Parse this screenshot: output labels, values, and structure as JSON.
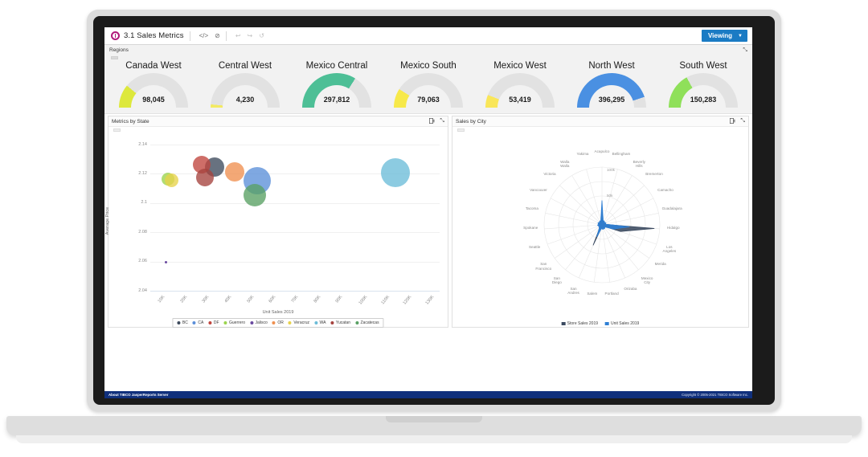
{
  "app": {
    "title": "3.1 Sales Metrics",
    "logo_icon": "jasper-logo-icon",
    "toolbar": {
      "code_icon": "</>",
      "timer_icon": "⊘",
      "undo_icon": "↩",
      "redo_icon": "↪",
      "refresh_icon": "↺"
    },
    "viewing_label": "Viewing",
    "viewing_caret": "▼"
  },
  "regions_panel": {
    "title": "Regions",
    "expand_icon": "⤡",
    "gauges": [
      {
        "name": "Canada West",
        "value": "98,045",
        "color": "#dde83c",
        "pct": 0.22
      },
      {
        "name": "Central West",
        "value": "4,230",
        "color": "#f3ea62",
        "pct": 0.03
      },
      {
        "name": "Mexico Central",
        "value": "297,812",
        "color": "#4dbf96",
        "pct": 0.68
      },
      {
        "name": "Mexico South",
        "value": "79,063",
        "color": "#f7e94a",
        "pct": 0.18
      },
      {
        "name": "Mexico West",
        "value": "53,419",
        "color": "#f9e659",
        "pct": 0.12
      },
      {
        "name": "North West",
        "value": "396,295",
        "color": "#4a90e2",
        "pct": 0.9
      },
      {
        "name": "South West",
        "value": "150,283",
        "color": "#8fe05a",
        "pct": 0.34
      }
    ],
    "gauge_track_color": "#e2e2e2"
  },
  "scatter_card": {
    "title": "Metrics by State",
    "export_icon": "export-icon",
    "expand_icon": "⤡"
  },
  "radar_card": {
    "title": "Sales by City",
    "export_icon": "export-icon",
    "expand_icon": "⤡"
  },
  "chart_data": [
    {
      "type": "scatter",
      "title": "Metrics by State",
      "xlabel": "Unit Sales 2019",
      "ylabel": "Average Price",
      "xticks": [
        "10K",
        "20K",
        "30K",
        "40K",
        "50K",
        "60K",
        "70K",
        "80K",
        "90K",
        "100K",
        "110K",
        "120K",
        "130K"
      ],
      "yticks": [
        "2.04",
        "2.06",
        "2.08",
        "2.1",
        "2.12",
        "2.14"
      ],
      "ylim": [
        2.04,
        2.14
      ],
      "xlim": [
        5000,
        135000
      ],
      "grid": true,
      "legend_position": "bottom",
      "series": [
        {
          "name": "BC",
          "color": "#3d4a5c",
          "x": 34000,
          "y": 2.1245,
          "size": 24
        },
        {
          "name": "CA",
          "color": "#5b8fd9",
          "x": 53000,
          "y": 2.1155,
          "size": 34
        },
        {
          "name": "DF",
          "color": "#c0453e",
          "x": 28000,
          "y": 2.1265,
          "size": 22
        },
        {
          "name": "Guerrero",
          "color": "#9ad44d",
          "x": 13000,
          "y": 2.1165,
          "size": 16
        },
        {
          "name": "Jalisco",
          "color": "#6a4aa0",
          "x": 12000,
          "y": 2.0595,
          "size": 3
        },
        {
          "name": "OR",
          "color": "#ef9050",
          "x": 43000,
          "y": 2.1215,
          "size": 24
        },
        {
          "name": "Veracruz",
          "color": "#e7d24a",
          "x": 14500,
          "y": 2.1155,
          "size": 17
        },
        {
          "name": "WA",
          "color": "#6cbcd8",
          "x": 115000,
          "y": 2.1205,
          "size": 36
        },
        {
          "name": "Yucatan",
          "color": "#a5423e",
          "x": 29500,
          "y": 2.1175,
          "size": 22
        },
        {
          "name": "Zacatecas",
          "color": "#58a063",
          "x": 52000,
          "y": 2.1055,
          "size": 28
        }
      ]
    },
    {
      "type": "radar",
      "title": "Sales by City",
      "radial_ticks": [
        "50k",
        "100k"
      ],
      "categories": [
        "Acapulco",
        "Bellingham",
        "Beverly Hills",
        "Bremerton",
        "Camacho",
        "Guadalajara",
        "Hidalgo",
        "Los Angeles",
        "Merida",
        "Mexico City",
        "Orizaba",
        "Portland",
        "Salem",
        "San Andres",
        "San Diego",
        "San Francisco",
        "Seattle",
        "Spokane",
        "Tacoma",
        "Vancouver",
        "Victoria",
        "Walla Walla",
        "Yakima"
      ],
      "series": [
        {
          "name": "Store Sales 2019",
          "color": "#3b4a60",
          "values": [
            30,
            8,
            8,
            6,
            8,
            6,
            118,
            44,
            6,
            8,
            8,
            8,
            6,
            50,
            8,
            6,
            6,
            8,
            6,
            8,
            6,
            8,
            8
          ]
        },
        {
          "name": "Unit Sales 2019",
          "color": "#2f7fd4",
          "values": [
            55,
            10,
            10,
            8,
            10,
            8,
            62,
            28,
            8,
            10,
            10,
            10,
            8,
            30,
            10,
            8,
            8,
            10,
            8,
            10,
            8,
            10,
            10
          ]
        }
      ],
      "legend_position": "bottom"
    }
  ],
  "footer": {
    "about": "About TIBCO JasperReports Server",
    "copyright": "Copyright © 2005-2021 TIBCO Software Inc."
  }
}
